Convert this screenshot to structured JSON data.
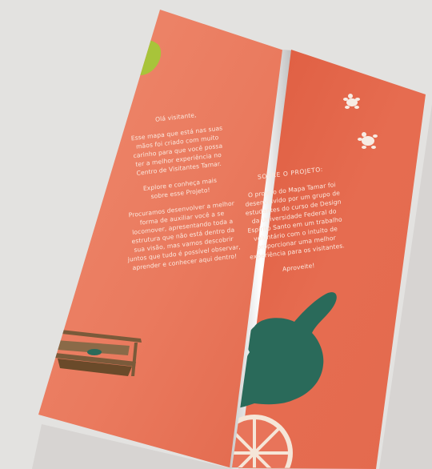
{
  "left_panel": {
    "greeting": "Olá visitante,",
    "paragraph_1": [
      "Esse mapa que está nas suas",
      "mãos foi criado com muito",
      "carinho para que você possa",
      "ter a melhor experiência no",
      "Centro de Visitantes Tamar."
    ],
    "paragraph_2": [
      "Explore e conheça mais",
      "sobre esse Projeto!"
    ],
    "paragraph_3": [
      "Procuramos desenvolver a melhor",
      "forma de auxiliar você a se",
      "locomover, apresentando toda a",
      "estrutura que não está dentro da",
      "sua visão, mas vamos descobrir",
      "juntos que tudo é possível observar,",
      "aprender e conhecer aqui dentro!"
    ]
  },
  "right_panel": {
    "heading": "SOBRE O PROJETO:",
    "paragraph_1": [
      "O projeto do Mapa Tamar foi",
      "desenvolvido por um grupo de",
      "estudantes do curso de Design",
      "da Universidade Federal do",
      "Espírito Santo em um trabalho",
      "voluntário com o intuito de",
      "proporcionar uma melhor",
      "experiência para os visitantes."
    ],
    "closing": "Aproveite!"
  },
  "colors": {
    "paper": "#e8745a",
    "paper_dark": "#d9583f",
    "teal": "#2a6a5a",
    "lime": "#a8c43a",
    "wood": "#7a5a3a",
    "text": "#fbe9df"
  }
}
